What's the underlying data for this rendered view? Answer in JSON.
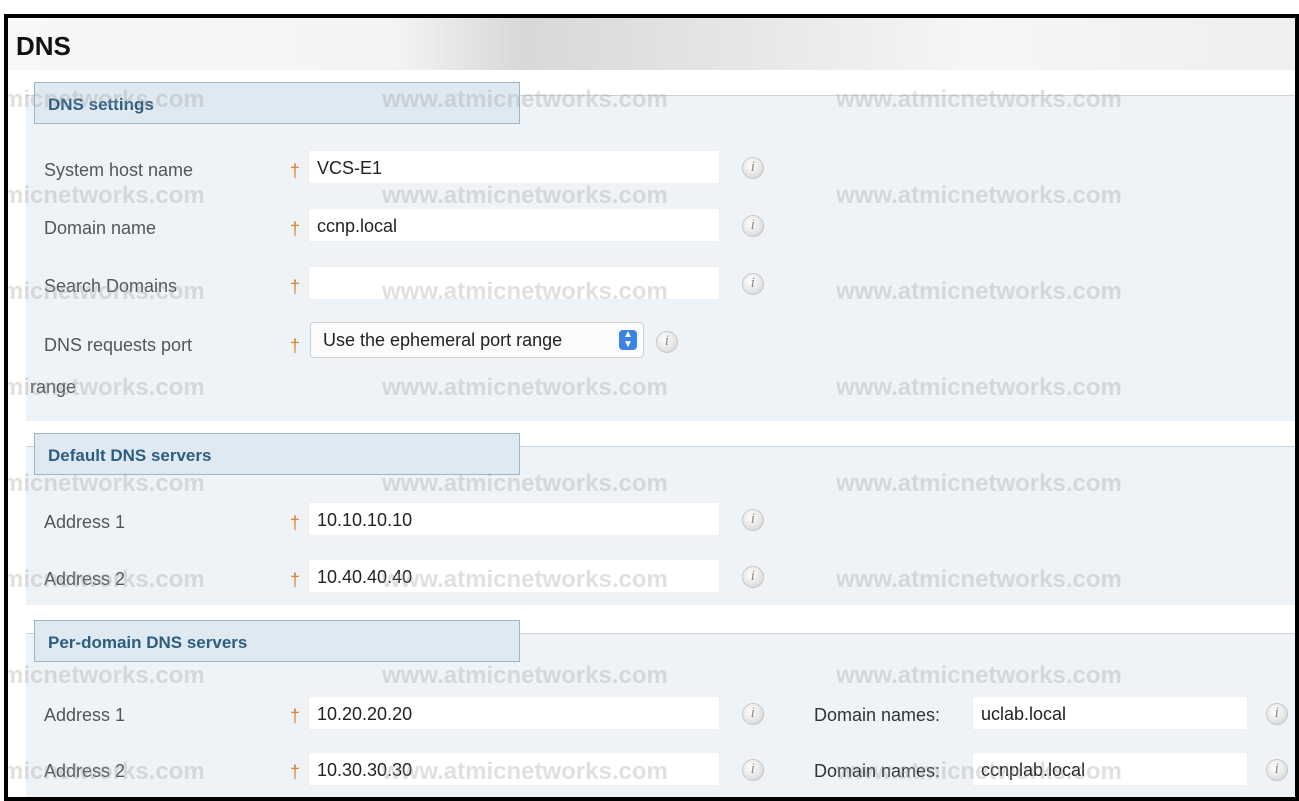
{
  "page": {
    "title": "DNS"
  },
  "dns_settings": {
    "legend": "DNS settings",
    "system_host_name": {
      "label": "System host name",
      "value": "VCS-E1"
    },
    "domain_name": {
      "label": "Domain name",
      "value": "ccnp.local"
    },
    "search_domains": {
      "label": "Search Domains",
      "value": ""
    },
    "dns_requests_port": {
      "label_line1": "DNS requests port",
      "label_line2": "range",
      "value": "Use the ephemeral port range"
    }
  },
  "default_dns": {
    "legend": "Default DNS servers",
    "address1": {
      "label": "Address 1",
      "value": "10.10.10.10"
    },
    "address2": {
      "label": "Address 2",
      "value": "10.40.40.40"
    }
  },
  "per_domain_dns": {
    "legend": "Per-domain DNS servers",
    "row1": {
      "label": "Address 1",
      "value": "10.20.20.20",
      "domain_label": "Domain names:",
      "domain_value": "uclab.local"
    },
    "row2": {
      "label": "Address 2",
      "value": "10.30.30.30",
      "domain_label": "Domain names:",
      "domain_value": "ccnplab.local"
    }
  },
  "symbols": {
    "required": "†",
    "info": "i"
  },
  "watermark": {
    "text": "www.atmicnetworks.com",
    "fragment": "micnetworks.com"
  },
  "colors": {
    "section_bg": "#eef3f7",
    "legend_text": "#2e5d80",
    "required_marker": "#d9822b",
    "select_arrow": "#3b82e8"
  }
}
